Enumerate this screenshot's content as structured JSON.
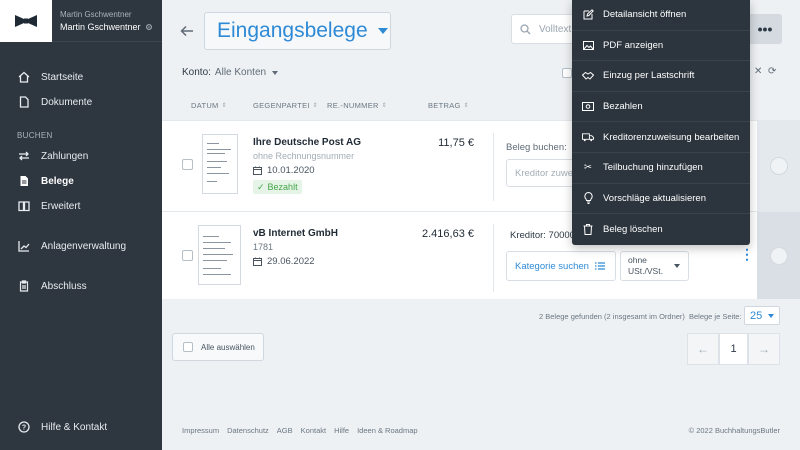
{
  "sidebar": {
    "user_label": "Martin Gschwentner",
    "user_name": "Martin Gschwentner",
    "items": [
      {
        "label": "Startseite",
        "icon": "home-icon"
      },
      {
        "label": "Dokumente",
        "icon": "document-icon"
      },
      {
        "label": "Zahlungen",
        "icon": "transfer-icon"
      },
      {
        "label": "Belege",
        "icon": "receipt-icon"
      },
      {
        "label": "Erweitert",
        "icon": "book-icon"
      },
      {
        "label": "Anlagenverwaltung",
        "icon": "chart-icon"
      },
      {
        "label": "Abschluss",
        "icon": "clipboard-icon"
      }
    ],
    "section_label": "BUCHEN",
    "help_label": "Hilfe & Kontakt"
  },
  "header": {
    "title": "Eingangsbelege",
    "search_placeholder": "Volltext",
    "konto_label": "Konto:",
    "konto_value": "Alle Konten"
  },
  "columns": {
    "datum": "DATUM",
    "gegenpartei": "GEGENPARTEI",
    "re_nummer": "RE.-NUMMER",
    "betrag": "BETRAG"
  },
  "rows": [
    {
      "party": "Ihre Deutsche Post AG",
      "invoice_number": "ohne Rechnungsnummer",
      "date": "10.01.2020",
      "status": "Bezahlt",
      "amount": "11,75 €",
      "booking_label": "Beleg buchen:",
      "kreditor_placeholder": "Kreditor zuwe"
    },
    {
      "party": "vB Internet GmbH",
      "invoice_number": "1781",
      "date": "29.06.2022",
      "amount": "2.416,63 €",
      "kreditor": "Kreditor: 70000",
      "category_button": "Kategorie suchen",
      "ust_line1": "ohne",
      "ust_line2": "USt./VSt."
    }
  ],
  "footer": {
    "found_text": "2 Belege gefunden (2 insgesamt im Ordner)",
    "per_page_label": "Belege je Seite:",
    "per_page_value": "25",
    "select_all": "Alle auswählen",
    "page": "1",
    "links": [
      "Impressum",
      "Datenschutz",
      "AGB",
      "Kontakt",
      "Hilfe",
      "Ideen & Roadmap"
    ],
    "copyright": "© 2022 BuchhaltungsButler"
  },
  "menu": {
    "items": [
      {
        "label": "Detailansicht öffnen",
        "icon": "edit-icon"
      },
      {
        "label": "PDF anzeigen",
        "icon": "image-icon"
      },
      {
        "label": "Einzug per Lastschrift",
        "icon": "handshake-icon"
      },
      {
        "label": "Bezahlen",
        "icon": "money-icon"
      },
      {
        "label": "Kreditorenzuweisung bearbeiten",
        "icon": "truck-icon"
      },
      {
        "label": "Teilbuchung hinzufügen",
        "icon": "scissors-icon"
      },
      {
        "label": "Vorschläge aktualisieren",
        "icon": "lightbulb-icon"
      },
      {
        "label": "Beleg löschen",
        "icon": "trash-icon"
      }
    ]
  },
  "colors": {
    "sidebar_bg": "#2e3640",
    "accent": "#2f8ad6",
    "menu_bg": "#2c343d",
    "paid_green": "#44a54c"
  }
}
